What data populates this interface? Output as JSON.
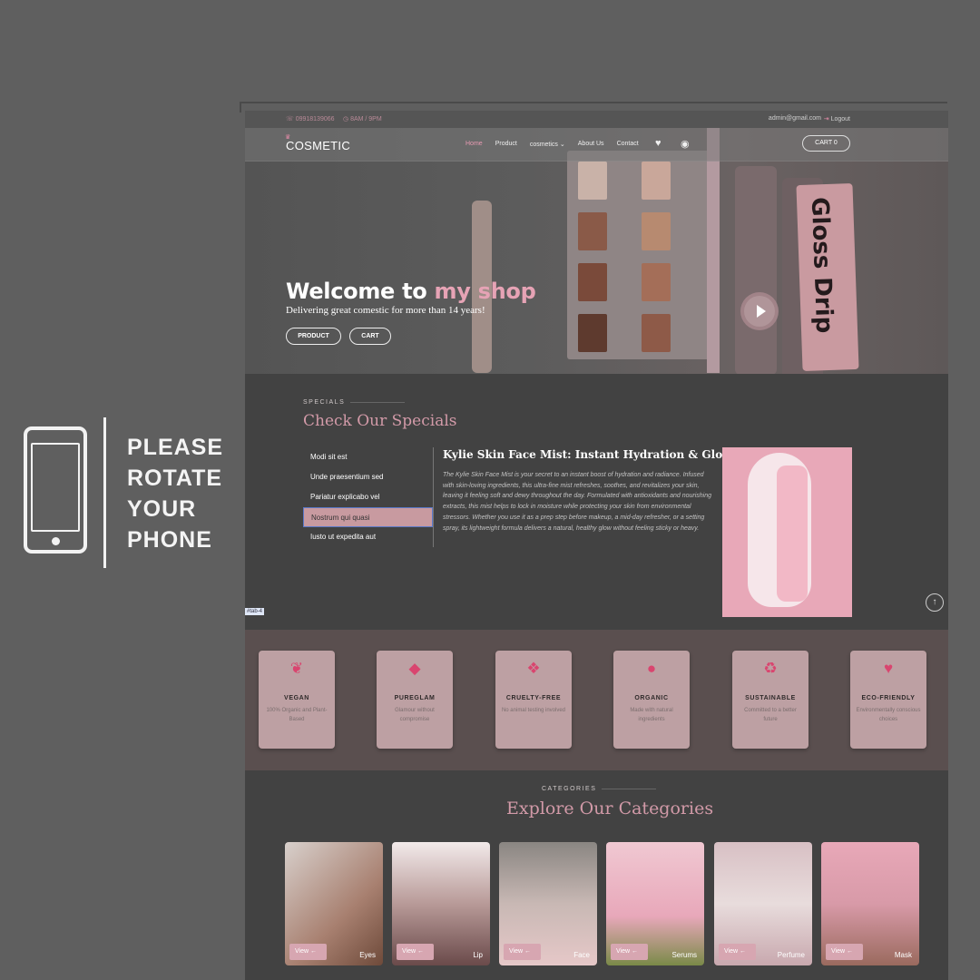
{
  "overlay": {
    "line1": "PLEASE",
    "line2": "ROTATE",
    "line3": "YOUR",
    "line4": "PHONE"
  },
  "topbar": {
    "phone": "09918139066",
    "hours": "8AM / 9PM",
    "email": "admin@gmail.com",
    "logout": "Logout"
  },
  "nav": {
    "logo": "COSMETIC",
    "links": [
      "Home",
      "Product",
      "cosmetics",
      "About Us",
      "Contact"
    ],
    "cart": "CART 0"
  },
  "hero": {
    "title_a": "Welcome to ",
    "title_b": "my shop",
    "subtitle": "Delivering great comestic for more than 14 years!",
    "btn_product": "PRODUCT",
    "btn_cart": "CART",
    "product_text": "Gloss Drip"
  },
  "specials": {
    "eyebrow": "SPECIALS",
    "title": "Check Our Specials",
    "tabs": [
      "Modi sit est",
      "Unde praesentium sed",
      "Pariatur explicabo vel",
      "Nostrum qui quasi",
      "Iusto ut expedita aut"
    ],
    "active_tab": 3,
    "tab_hint": "#tab-4",
    "item_title": "Kylie Skin Face Mist: Instant Hydration & Glow",
    "item_desc": "The Kylie Skin Face Mist is your secret to an instant boost of hydration and radiance. Infused with skin-loving ingredients, this ultra-fine mist refreshes, soothes, and revitalizes your skin, leaving it feeling soft and dewy throughout the day. Formulated with antioxidants and nourishing extracts, this mist helps to lock in moisture while protecting your skin from environmental stressors. Whether you use it as a prep step before makeup, a mid-day refresher, or a setting spray, its lightweight formula delivers a natural, healthy glow without feeling sticky or heavy."
  },
  "features": [
    {
      "name": "VEGAN",
      "desc": "100% Organic and Plant-Based",
      "icon": "leaf-icon"
    },
    {
      "name": "PUREGLAM",
      "desc": "Glamour without compromise",
      "icon": "gem-icon"
    },
    {
      "name": "CRUELTY-FREE",
      "desc": "No animal testing involved",
      "icon": "paw-icon"
    },
    {
      "name": "ORGANIC",
      "desc": "Made with natural ingredients",
      "icon": "leaf-icon"
    },
    {
      "name": "SUSTAINABLE",
      "desc": "Committed to a better future",
      "icon": "recycle-icon"
    },
    {
      "name": "ECO-FRIENDLY",
      "desc": "Environmentally conscious choices",
      "icon": "heart-icon"
    }
  ],
  "categories": {
    "eyebrow": "CATEGORIES",
    "title": "Explore Our Categories",
    "view_label": "View ←",
    "items": [
      "Eyes",
      "Lip",
      "Face",
      "Serums",
      "Perfume",
      "Mask"
    ]
  },
  "colors": {
    "accent": "#e6a3b5",
    "card": "#bda0a3",
    "icon": "#d9456f"
  }
}
